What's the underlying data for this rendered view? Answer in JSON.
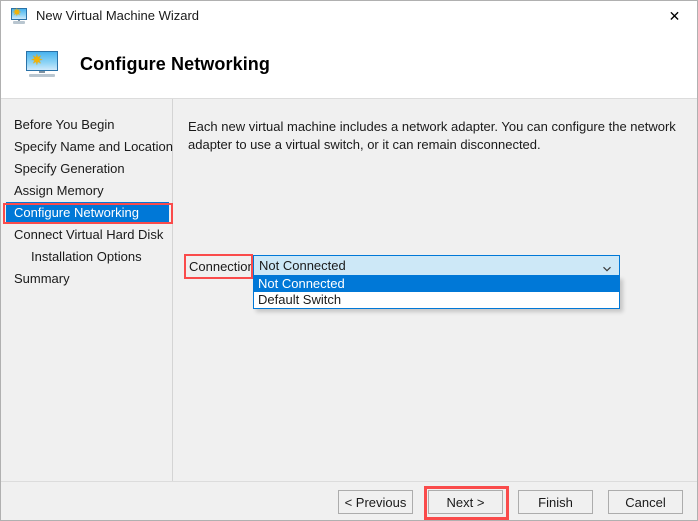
{
  "window": {
    "title": "New Virtual Machine Wizard",
    "title_icon": "virtual-machine-monitor-icon",
    "close_label": "✕"
  },
  "header": {
    "icon": "virtual-machine-monitor-icon",
    "title": "Configure Networking"
  },
  "sidebar": {
    "items": [
      {
        "label": "Before You Begin",
        "active": false,
        "indent": false
      },
      {
        "label": "Specify Name and Location",
        "active": false,
        "indent": false
      },
      {
        "label": "Specify Generation",
        "active": false,
        "indent": false
      },
      {
        "label": "Assign Memory",
        "active": false,
        "indent": false
      },
      {
        "label": "Configure Networking",
        "active": true,
        "indent": false
      },
      {
        "label": "Connect Virtual Hard Disk",
        "active": false,
        "indent": false
      },
      {
        "label": "Installation Options",
        "active": false,
        "indent": true
      },
      {
        "label": "Summary",
        "active": false,
        "indent": false
      }
    ]
  },
  "main": {
    "intro_text": "Each new virtual machine includes a network adapter. You can configure the network adapter to use a virtual switch, or it can remain disconnected.",
    "connection": {
      "label": "Connection:",
      "selected_value": "Not Connected",
      "expanded": true,
      "chevron_icon": "chevron-down-icon",
      "options": [
        {
          "label": "Not Connected",
          "selected": true
        },
        {
          "label": "Default Switch",
          "selected": false
        }
      ]
    }
  },
  "footer": {
    "buttons": [
      {
        "label": "< Previous",
        "highlighted": false
      },
      {
        "label": "Next >",
        "highlighted": true
      },
      {
        "label": "Finish",
        "highlighted": false
      },
      {
        "label": "Cancel",
        "highlighted": false
      }
    ]
  },
  "colors": {
    "accent": "#0078d7",
    "highlight_box": "#fa4b4b",
    "panel_bg": "#f0f0f0",
    "combo_bg": "#cde8f7"
  }
}
